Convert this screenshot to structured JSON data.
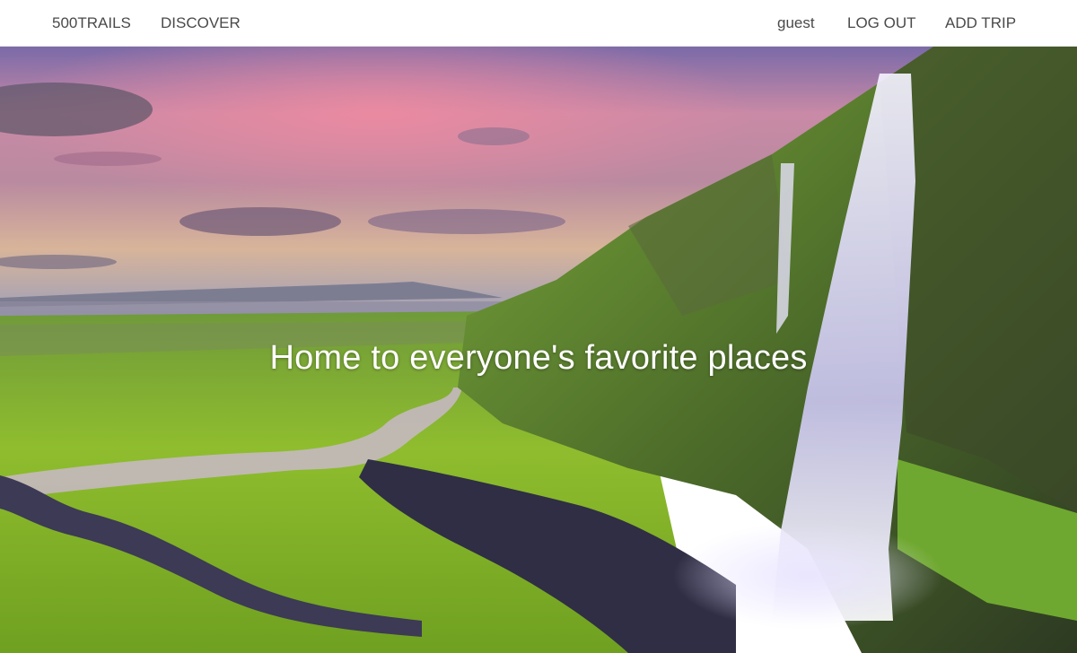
{
  "nav": {
    "brand": "500TRAILS",
    "discover": "DISCOVER",
    "user": "guest",
    "logout": "LOG OUT",
    "add_trip": "ADD TRIP"
  },
  "hero": {
    "tagline": "Home to everyone's favorite places",
    "image": "waterfall-landscape-photo"
  },
  "colors": {
    "nav_bg": "#ffffff",
    "nav_text": "#4a4a4a",
    "tagline": "#ffffff"
  }
}
